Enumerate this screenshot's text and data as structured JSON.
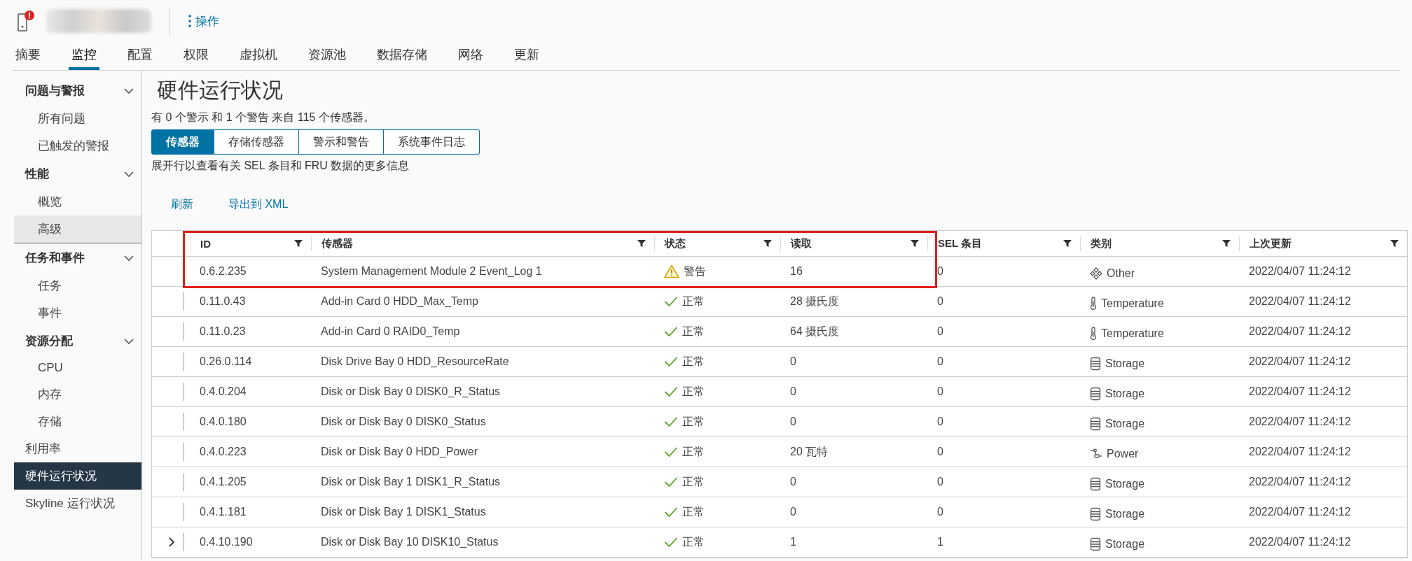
{
  "header": {
    "actions_label": "操作"
  },
  "tabs": [
    {
      "label": "摘要",
      "selected": false
    },
    {
      "label": "监控",
      "selected": true
    },
    {
      "label": "配置",
      "selected": false
    },
    {
      "label": "权限",
      "selected": false
    },
    {
      "label": "虚拟机",
      "selected": false
    },
    {
      "label": "资源池",
      "selected": false
    },
    {
      "label": "数据存储",
      "selected": false
    },
    {
      "label": "网络",
      "selected": false
    },
    {
      "label": "更新",
      "selected": false
    }
  ],
  "sidebar": {
    "items": [
      {
        "kind": "group",
        "label": "问题与警报",
        "expanded": true,
        "children": [
          {
            "label": "所有问题",
            "selected": false,
            "highlighted": false
          },
          {
            "label": "已触发的警报",
            "selected": false,
            "highlighted": false
          }
        ]
      },
      {
        "kind": "group",
        "label": "性能",
        "expanded": true,
        "children": [
          {
            "label": "概览",
            "selected": false,
            "highlighted": false
          },
          {
            "label": "高级",
            "selected": false,
            "highlighted": true
          }
        ]
      },
      {
        "kind": "group",
        "label": "任务和事件",
        "expanded": true,
        "children": [
          {
            "label": "任务",
            "selected": false,
            "highlighted": false
          },
          {
            "label": "事件",
            "selected": false,
            "highlighted": false
          }
        ]
      },
      {
        "kind": "group",
        "label": "资源分配",
        "expanded": true,
        "children": [
          {
            "label": "CPU",
            "selected": false,
            "highlighted": false
          },
          {
            "label": "内存",
            "selected": false,
            "highlighted": false
          },
          {
            "label": "存储",
            "selected": false,
            "highlighted": false
          }
        ]
      },
      {
        "kind": "link",
        "label": "利用率",
        "selected": false,
        "highlighted": false
      },
      {
        "kind": "link",
        "label": "硬件运行状况",
        "selected": true,
        "highlighted": false
      },
      {
        "kind": "link",
        "label": "Skyline 运行状况",
        "selected": false,
        "highlighted": false
      }
    ]
  },
  "content": {
    "title": "硬件运行状况",
    "summary": "有 0 个警示 和 1 个警告 来自 115 个传感器。",
    "segments": [
      {
        "label": "传感器",
        "selected": true
      },
      {
        "label": "存储传感器",
        "selected": false
      },
      {
        "label": "警示和警告",
        "selected": false
      },
      {
        "label": "系统事件日志",
        "selected": false
      }
    ],
    "hint": "展开行以查看有关 SEL 条目和 FRU 数据的更多信息",
    "actions": [
      "刷新",
      "导出到 XML"
    ]
  },
  "table": {
    "highlight": true,
    "columns": [
      "ID",
      "传感器",
      "状态",
      "读取",
      "SEL 条目",
      "类别",
      "上次更新"
    ],
    "rows": [
      {
        "expandable": false,
        "id": "0.6.2.235",
        "sensor": "System Management Module 2 Event_Log 1",
        "status": {
          "kind": "warning",
          "text": "警告"
        },
        "reading": "16",
        "sel": "0",
        "category": {
          "kind": "other",
          "text": "Other"
        },
        "updated": "2022/04/07 11:24:12"
      },
      {
        "expandable": false,
        "id": "0.11.0.43",
        "sensor": "Add-in Card 0 HDD_Max_Temp",
        "status": {
          "kind": "ok",
          "text": "正常"
        },
        "reading": "28 摄氏度",
        "sel": "0",
        "category": {
          "kind": "temperature",
          "text": "Temperature"
        },
        "updated": "2022/04/07 11:24:12"
      },
      {
        "expandable": false,
        "id": "0.11.0.23",
        "sensor": "Add-in Card 0 RAID0_Temp",
        "status": {
          "kind": "ok",
          "text": "正常"
        },
        "reading": "64 摄氏度",
        "sel": "0",
        "category": {
          "kind": "temperature",
          "text": "Temperature"
        },
        "updated": "2022/04/07 11:24:12"
      },
      {
        "expandable": false,
        "id": "0.26.0.114",
        "sensor": "Disk Drive Bay 0 HDD_ResourceRate",
        "status": {
          "kind": "ok",
          "text": "正常"
        },
        "reading": "0",
        "sel": "0",
        "category": {
          "kind": "storage",
          "text": "Storage"
        },
        "updated": "2022/04/07 11:24:12"
      },
      {
        "expandable": false,
        "id": "0.4.0.204",
        "sensor": "Disk or Disk Bay 0 DISK0_R_Status",
        "status": {
          "kind": "ok",
          "text": "正常"
        },
        "reading": "0",
        "sel": "0",
        "category": {
          "kind": "storage",
          "text": "Storage"
        },
        "updated": "2022/04/07 11:24:12"
      },
      {
        "expandable": false,
        "id": "0.4.0.180",
        "sensor": "Disk or Disk Bay 0 DISK0_Status",
        "status": {
          "kind": "ok",
          "text": "正常"
        },
        "reading": "0",
        "sel": "0",
        "category": {
          "kind": "storage",
          "text": "Storage"
        },
        "updated": "2022/04/07 11:24:12"
      },
      {
        "expandable": false,
        "id": "0.4.0.223",
        "sensor": "Disk or Disk Bay 0 HDD_Power",
        "status": {
          "kind": "ok",
          "text": "正常"
        },
        "reading": "20 瓦特",
        "sel": "0",
        "category": {
          "kind": "power",
          "text": "Power"
        },
        "updated": "2022/04/07 11:24:12"
      },
      {
        "expandable": false,
        "id": "0.4.1.205",
        "sensor": "Disk or Disk Bay 1 DISK1_R_Status",
        "status": {
          "kind": "ok",
          "text": "正常"
        },
        "reading": "0",
        "sel": "0",
        "category": {
          "kind": "storage",
          "text": "Storage"
        },
        "updated": "2022/04/07 11:24:12"
      },
      {
        "expandable": false,
        "id": "0.4.1.181",
        "sensor": "Disk or Disk Bay 1 DISK1_Status",
        "status": {
          "kind": "ok",
          "text": "正常"
        },
        "reading": "0",
        "sel": "0",
        "category": {
          "kind": "storage",
          "text": "Storage"
        },
        "updated": "2022/04/07 11:24:12"
      },
      {
        "expandable": true,
        "id": "0.4.10.190",
        "sensor": "Disk or Disk Bay 10 DISK10_Status",
        "status": {
          "kind": "ok",
          "text": "正常"
        },
        "reading": "1",
        "sel": "1",
        "category": {
          "kind": "storage",
          "text": "Storage"
        },
        "updated": "2022/04/07 11:24:12"
      }
    ]
  }
}
